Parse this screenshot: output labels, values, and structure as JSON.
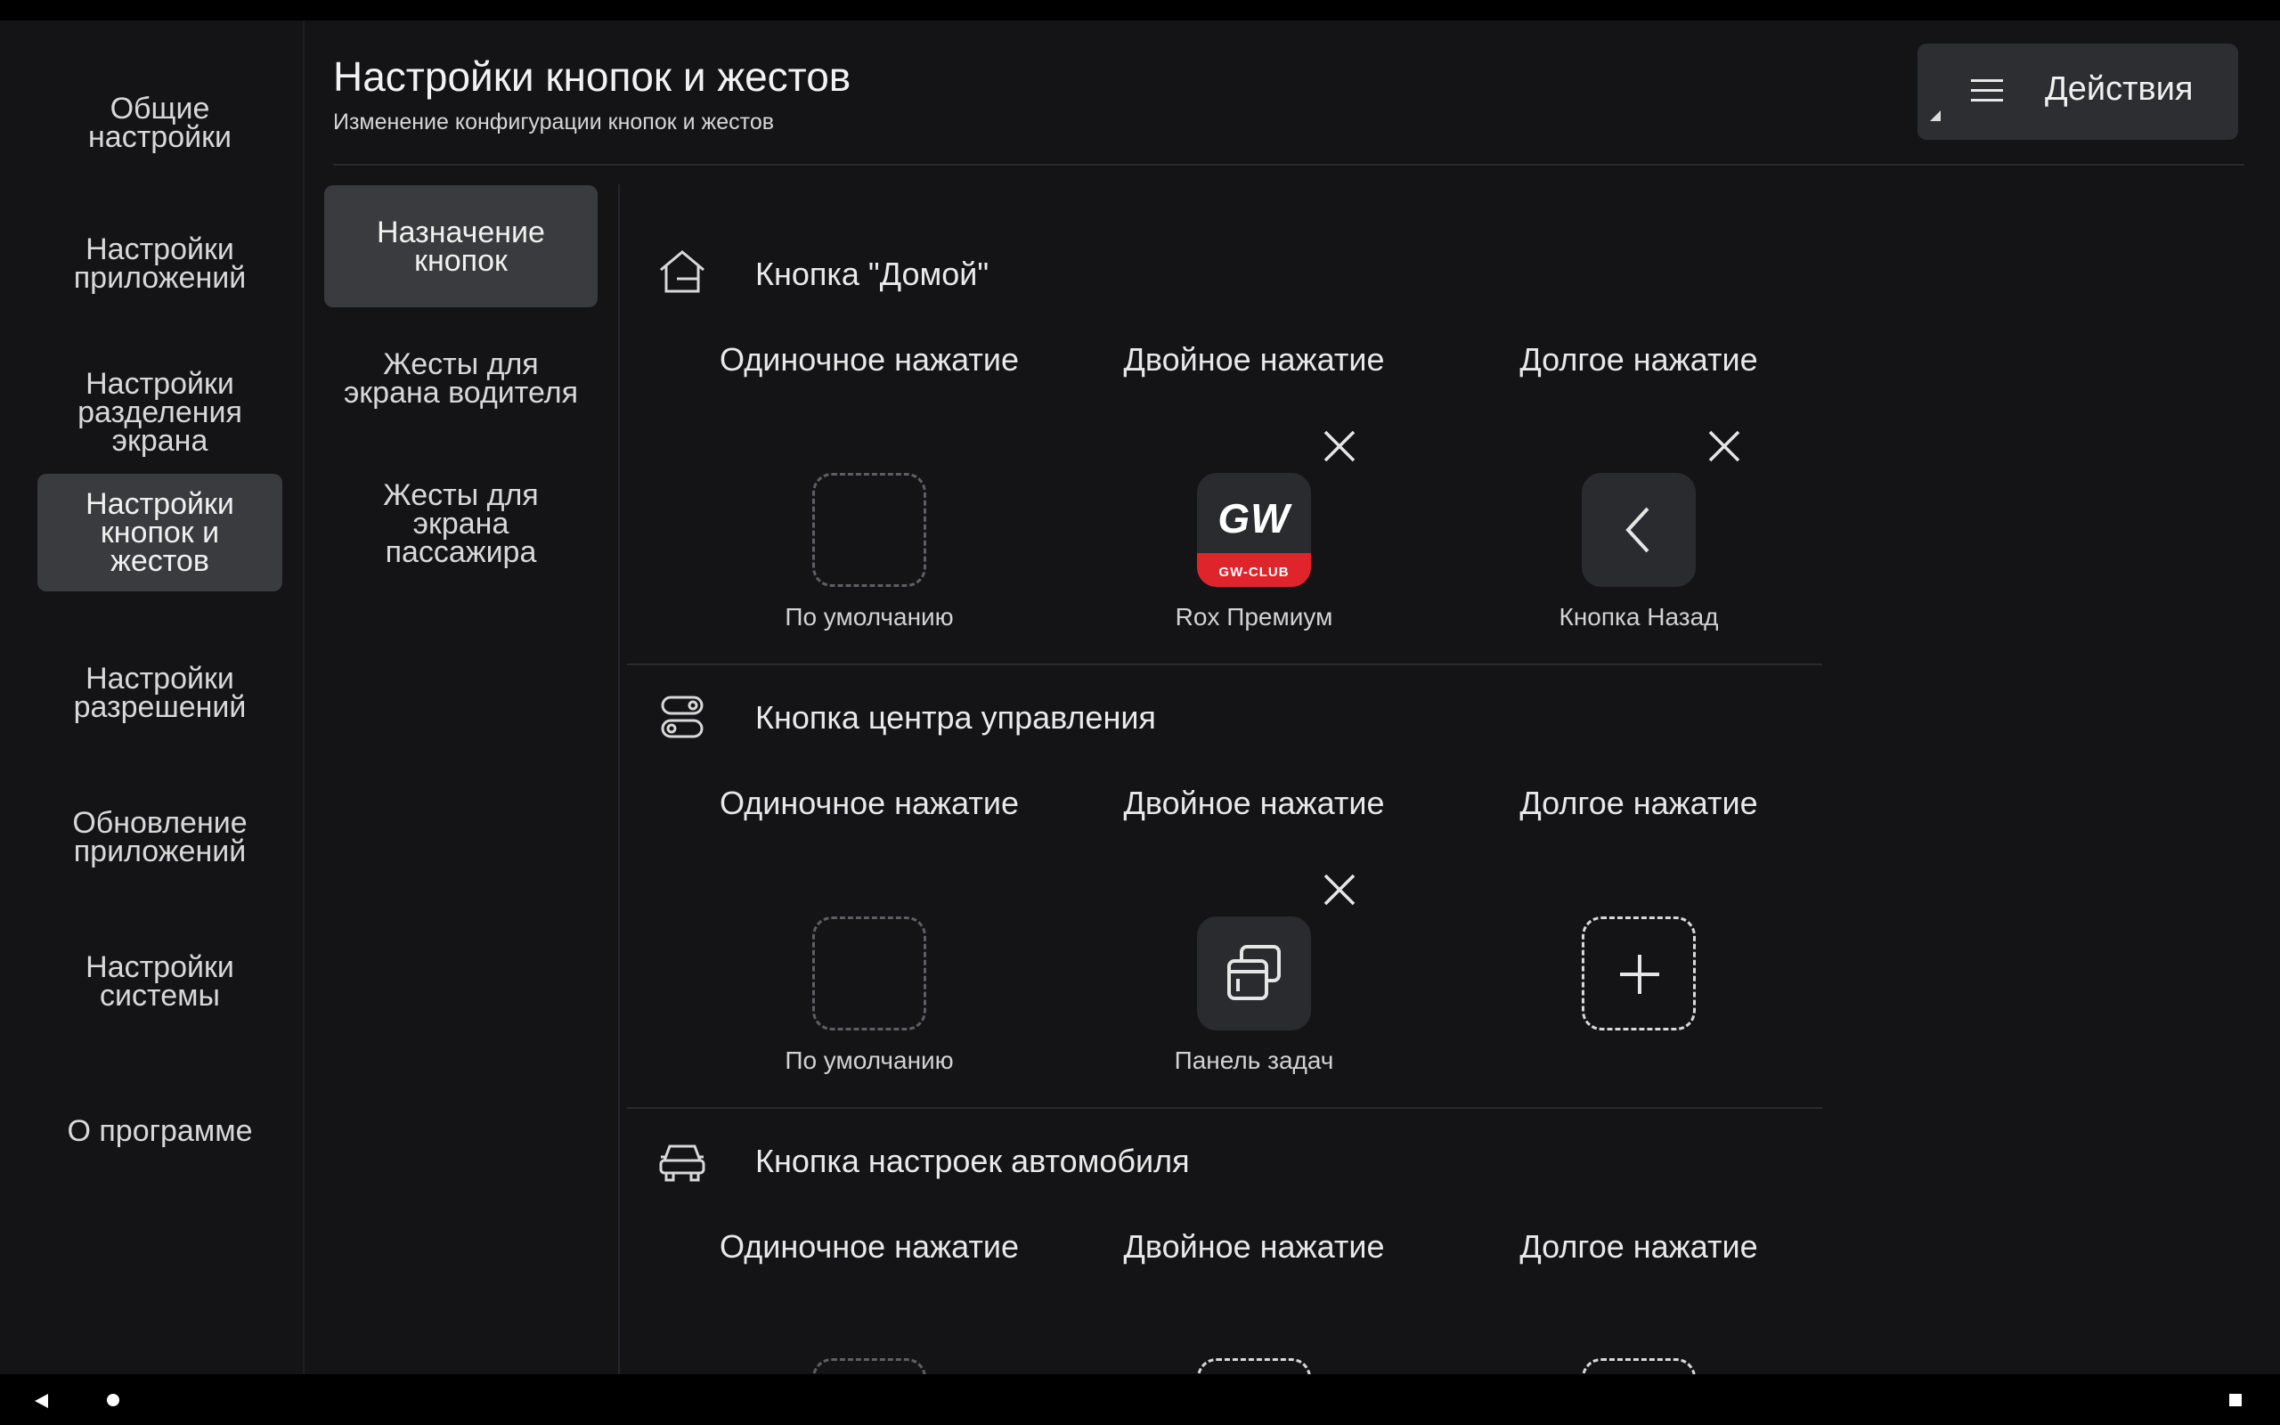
{
  "nav": {
    "items": [
      {
        "label": "Общие\nнастройки"
      },
      {
        "label": "Настройки\nприложений"
      },
      {
        "label": "Настройки\nразделения\nэкрана"
      },
      {
        "label": "Настройки\nкнопок и\nжестов"
      },
      {
        "label": "Настройки\nразрешений"
      },
      {
        "label": "Обновление\nприложений"
      },
      {
        "label": "Настройки\nсистемы"
      },
      {
        "label": "О программе"
      }
    ],
    "active_index": 3
  },
  "header": {
    "title": "Настройки кнопок и жестов",
    "subtitle": "Изменение конфигурации кнопок и жестов",
    "actions_label": "Действия"
  },
  "subnav": {
    "items": [
      {
        "label": "Назначение\nкнопок"
      },
      {
        "label": "Жесты для\nэкрана водителя"
      },
      {
        "label": "Жесты для\nэкрана\nпассажира"
      }
    ],
    "active_index": 0
  },
  "sections": [
    {
      "title": "Кнопка \"Домой\"",
      "icon": "home-icon",
      "columns": [
        {
          "label": "Одиночное нажатие",
          "slot": "empty",
          "value": "По умолчанию"
        },
        {
          "label": "Двойное нажатие",
          "slot": "app-gw",
          "value": "Rox Премиум",
          "removable": true
        },
        {
          "label": "Долгое нажатие",
          "slot": "back",
          "value": "Кнопка Назад",
          "removable": true
        }
      ]
    },
    {
      "title": "Кнопка центра управления",
      "icon": "toggles-icon",
      "columns": [
        {
          "label": "Одиночное нажатие",
          "slot": "empty",
          "value": "По умолчанию"
        },
        {
          "label": "Двойное нажатие",
          "slot": "taskbar",
          "value": "Панель задач",
          "removable": true
        },
        {
          "label": "Долгое нажатие",
          "slot": "add",
          "value": ""
        }
      ]
    },
    {
      "title": "Кнопка настроек автомобиля",
      "icon": "car-icon",
      "columns": [
        {
          "label": "Одиночное нажатие",
          "slot": "empty",
          "value": ""
        },
        {
          "label": "Двойное нажатие",
          "slot": "add",
          "value": ""
        },
        {
          "label": "Долгое нажатие",
          "slot": "add",
          "value": ""
        }
      ]
    }
  ],
  "logo": {
    "main": "GW",
    "sub": "GW-CLUB"
  },
  "colors": {
    "background": "#141416",
    "active": "#3a3b3e",
    "accent_red": "#e0242c"
  }
}
